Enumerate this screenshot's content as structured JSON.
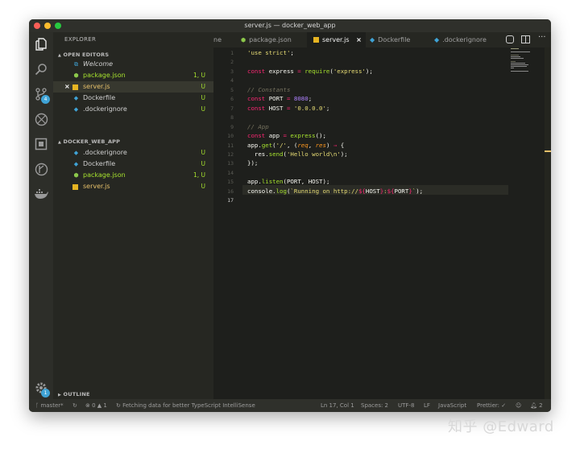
{
  "window": {
    "title": "server.js — docker_web_app"
  },
  "colors": {
    "accent": "#3fa3d6",
    "keyword": "#f92672",
    "string": "#e6db74",
    "comment": "#75715e",
    "number": "#ae81ff",
    "function": "#a6e22e",
    "param": "#fd971f",
    "modified": "#e6c06a"
  },
  "activity": {
    "scm_badge": "4",
    "settings_badge": "1"
  },
  "sidebar": {
    "title": "EXPLORER",
    "open_editors_label": "OPEN EDITORS",
    "open_editors": [
      {
        "name": "Welcome",
        "icon": "vscode-icon",
        "status": ""
      },
      {
        "name": "package.json",
        "icon": "node-icon",
        "status": "1, U"
      },
      {
        "name": "server.js",
        "icon": "js-icon",
        "status": "U"
      },
      {
        "name": "Dockerfile",
        "icon": "docker-icon",
        "status": "U"
      },
      {
        "name": ".dockerignore",
        "icon": "docker-icon",
        "status": "U"
      }
    ],
    "project_label": "DOCKER_WEB_APP",
    "files": [
      {
        "name": ".dockerignore",
        "icon": "docker-icon",
        "status": "U"
      },
      {
        "name": "Dockerfile",
        "icon": "docker-icon",
        "status": "U"
      },
      {
        "name": "package.json",
        "icon": "node-icon",
        "status": "1, U"
      },
      {
        "name": "server.js",
        "icon": "js-icon",
        "status": "U"
      }
    ],
    "outline_label": "OUTLINE"
  },
  "tabs": [
    {
      "label": "ne"
    },
    {
      "label": "package.json"
    },
    {
      "label": "server.js",
      "close": "×"
    },
    {
      "label": "Dockerfile"
    },
    {
      "label": ".dockerignore"
    }
  ],
  "code_lines": [
    {
      "n": "1",
      "tokens": [
        [
          "'use strict'",
          "string"
        ],
        [
          ";",
          "plain"
        ]
      ]
    },
    {
      "n": "2",
      "tokens": []
    },
    {
      "n": "3",
      "tokens": [
        [
          "const ",
          "keyword"
        ],
        [
          "express",
          "plain"
        ],
        [
          " = ",
          "keyword"
        ],
        [
          "require",
          "function"
        ],
        [
          "(",
          "plain"
        ],
        [
          "'express'",
          "string"
        ],
        [
          ");",
          "plain"
        ]
      ]
    },
    {
      "n": "4",
      "tokens": []
    },
    {
      "n": "5",
      "tokens": [
        [
          "// Constants",
          "comment"
        ]
      ]
    },
    {
      "n": "6",
      "tokens": [
        [
          "const ",
          "keyword"
        ],
        [
          "PORT",
          "plain"
        ],
        [
          " = ",
          "keyword"
        ],
        [
          "8080",
          "number"
        ],
        [
          ";",
          "plain"
        ]
      ]
    },
    {
      "n": "7",
      "tokens": [
        [
          "const ",
          "keyword"
        ],
        [
          "HOST",
          "plain"
        ],
        [
          " = ",
          "keyword"
        ],
        [
          "'0.0.0.0'",
          "string"
        ],
        [
          ";",
          "plain"
        ]
      ]
    },
    {
      "n": "8",
      "tokens": []
    },
    {
      "n": "9",
      "tokens": [
        [
          "// App",
          "comment"
        ]
      ]
    },
    {
      "n": "10",
      "tokens": [
        [
          "const ",
          "keyword"
        ],
        [
          "app",
          "plain"
        ],
        [
          " = ",
          "keyword"
        ],
        [
          "express",
          "function"
        ],
        [
          "();",
          "plain"
        ]
      ]
    },
    {
      "n": "11",
      "tokens": [
        [
          "app.",
          "plain"
        ],
        [
          "get",
          "function"
        ],
        [
          "(",
          "plain"
        ],
        [
          "'/'",
          "string"
        ],
        [
          ", (",
          "plain"
        ],
        [
          "req",
          "param"
        ],
        [
          ", ",
          "plain"
        ],
        [
          "res",
          "param"
        ],
        [
          ") ",
          "plain"
        ],
        [
          "⇒",
          "keyword"
        ],
        [
          " {",
          "plain"
        ]
      ]
    },
    {
      "n": "12",
      "tokens": [
        [
          "  res.",
          "plain"
        ],
        [
          "send",
          "function"
        ],
        [
          "(",
          "plain"
        ],
        [
          "'Hello world\\n'",
          "string"
        ],
        [
          ");",
          "plain"
        ]
      ]
    },
    {
      "n": "13",
      "tokens": [
        [
          "});",
          "plain"
        ]
      ]
    },
    {
      "n": "14",
      "tokens": []
    },
    {
      "n": "15",
      "tokens": [
        [
          "app.",
          "plain"
        ],
        [
          "listen",
          "function"
        ],
        [
          "(",
          "plain"
        ],
        [
          "PORT",
          "plain"
        ],
        [
          ", ",
          "plain"
        ],
        [
          "HOST",
          "plain"
        ],
        [
          ");",
          "plain"
        ]
      ]
    },
    {
      "n": "16",
      "tokens": [
        [
          "console.",
          "plain"
        ],
        [
          "log",
          "function"
        ],
        [
          "(",
          "plain"
        ],
        [
          "`Running on ",
          "string"
        ],
        [
          "http://",
          "string"
        ],
        [
          "${",
          "keyword"
        ],
        [
          "HOST",
          "plain"
        ],
        [
          "}",
          "keyword"
        ],
        [
          ":",
          "string"
        ],
        [
          "${",
          "keyword"
        ],
        [
          "PORT",
          "plain"
        ],
        [
          "}",
          "keyword"
        ],
        [
          "`",
          "string"
        ],
        [
          ");",
          "plain"
        ]
      ]
    },
    {
      "n": "17",
      "tokens": []
    }
  ],
  "status": {
    "branch": "master*",
    "sync_icon": "sync-icon",
    "errors": "0",
    "warnings": "1",
    "message": "Fetching data for better TypeScript IntelliSense",
    "position": "Ln 17, Col 1",
    "spaces": "Spaces: 2",
    "encoding": "UTF-8",
    "eol": "LF",
    "language": "JavaScript",
    "prettier": "Prettier: ✓",
    "notifications": "2"
  },
  "watermark": "知乎 @Edward"
}
